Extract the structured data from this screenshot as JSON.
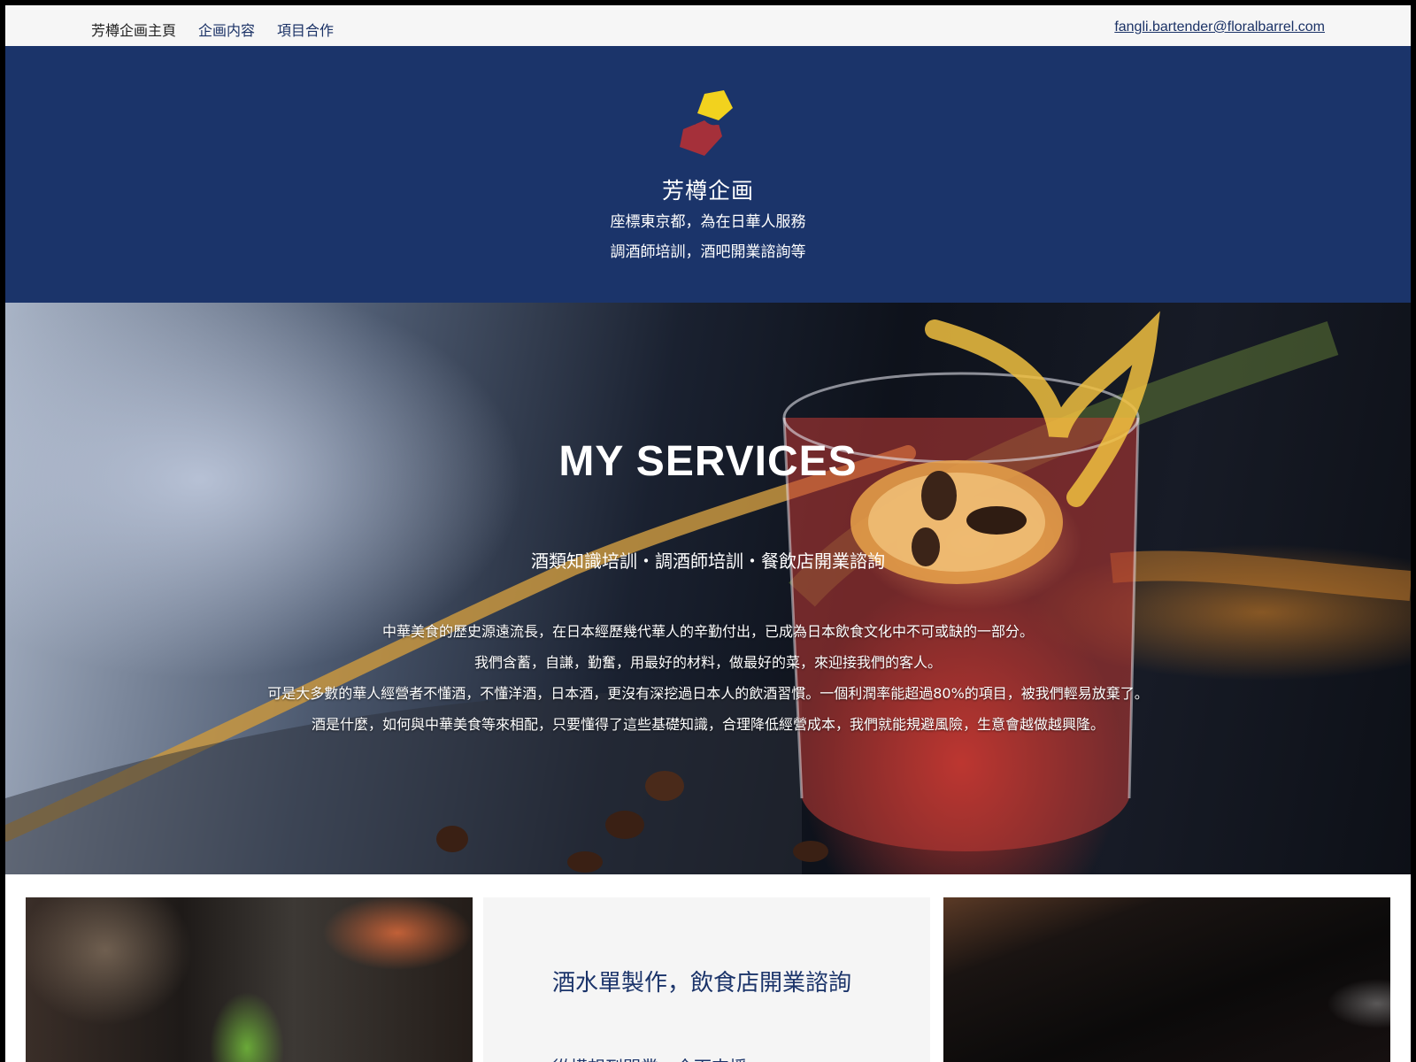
{
  "nav": {
    "items": [
      {
        "label": "芳樽企画主頁"
      },
      {
        "label": "企画内容"
      },
      {
        "label": "項目合作"
      }
    ],
    "email": "fangli.bartender@floralbarrel.com"
  },
  "header": {
    "brand": "芳樽企画",
    "line1": "座標東京都，為在日華人服務",
    "line2": "調酒師培訓，酒吧開業諮詢等",
    "colors": {
      "background": "#1b346a",
      "logo_yellow": "#f2d21e",
      "logo_red": "#a5303a"
    }
  },
  "services": {
    "title": "MY SERVICES",
    "subtitle": "酒類知識培訓・調酒師培訓・餐飲店開業諮詢",
    "paragraph": [
      "中華美食的歷史源遠流長，在日本經歷幾代華人的辛勤付出，已成為日本飲食文化中不可或缺的一部分。",
      "我們含蓄，自謙，勤奮，用最好的材料，做最好的菜，來迎接我們的客人。",
      "可是大多數的華人經營者不懂酒，不懂洋酒，日本酒，更沒有深挖過日本人的飲酒習慣。一個利潤率能超過80%的項目，被我們輕易放棄了。",
      "酒是什麼，如何與中華美食等來相配，只要懂得了這些基礎知識，合理降低經營成本，我們就能規避風險，生意會越做越興隆。"
    ]
  },
  "card": {
    "title": "酒水單製作，飲食店開業諮詢",
    "subtitle": "從構想到開業，全面支援"
  }
}
